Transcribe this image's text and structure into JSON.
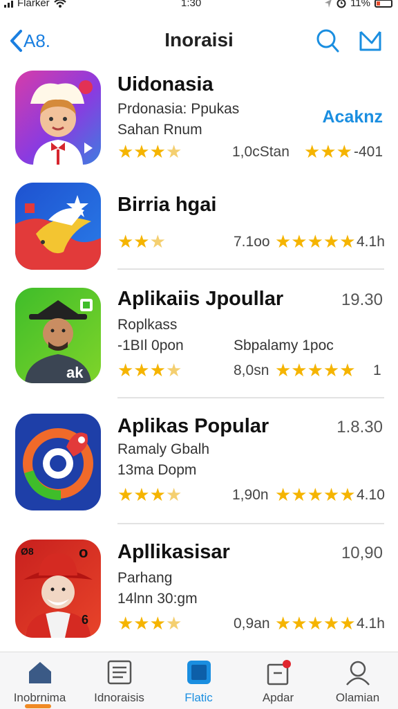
{
  "status": {
    "carrier": "Flarker",
    "time": "1:30",
    "battery": "11%"
  },
  "nav": {
    "back_label": "A8.",
    "title": "Inoraisi"
  },
  "apps": [
    {
      "name": "Uidonasia",
      "line1": "Prdonasia: Ppukas",
      "line2": "Sahan Rnum",
      "stars_left": "★★★",
      "half_left": "★",
      "meta": "1,0cStan",
      "stars_right": "★★★",
      "meta_right": "-401",
      "action": "Acaknz",
      "price": ""
    },
    {
      "name": "Birria hgai",
      "line1": "",
      "line2": "",
      "stars_left": "★★",
      "half_left": "★",
      "meta": "7.1oo",
      "stars_right": "★★★★★",
      "meta_right": "4.1h",
      "action": "",
      "price": ""
    },
    {
      "name": "Aplikaiis Jpoullar",
      "line1": "Roplkass",
      "line2": "-1BIl 0pon",
      "line2b": "Sbpalamy 1poc",
      "stars_left": "★★★",
      "half_left": "★",
      "meta": "8,0sn",
      "stars_right": "★★★★★",
      "meta_right": "1",
      "action": "",
      "price": "19.30"
    },
    {
      "name": "Aplikas Popular",
      "line1": "Ramaly Gbalh",
      "line2": "13ma Dopm",
      "stars_left": "★★★",
      "half_left": "★",
      "meta": "1,90n",
      "stars_right": "★★★★★",
      "meta_right": "4.10",
      "action": "",
      "price": "1.8.30"
    },
    {
      "name": "Apllikasisar",
      "line1": "Parhang",
      "line2": "14lnn 30:gm",
      "stars_left": "★★★",
      "half_left": "★",
      "meta": "0,9an",
      "stars_right": "★★★★★",
      "meta_right": "4.1h",
      "action": "",
      "price": "10,90"
    }
  ],
  "tabs": [
    {
      "label": "Inobrnima",
      "icon": "home-icon"
    },
    {
      "label": "Idnoraisis",
      "icon": "list-icon"
    },
    {
      "label": "Flatic",
      "icon": "square-app-icon"
    },
    {
      "label": "Apdar",
      "icon": "updates-icon"
    },
    {
      "label": "Olamian",
      "icon": "profile-icon"
    }
  ],
  "colors": {
    "accent": "#1a8ee0",
    "star": "#f5b400",
    "home_underline": "#f08a24"
  }
}
